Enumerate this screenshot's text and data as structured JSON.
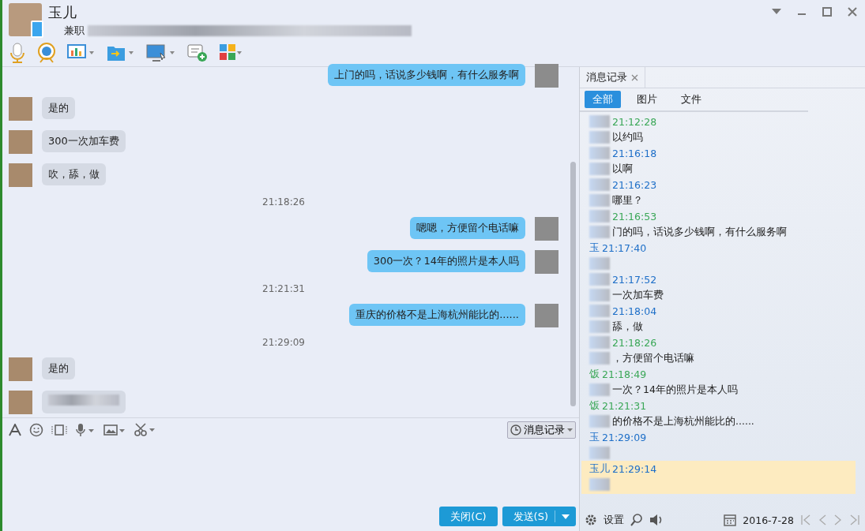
{
  "header": {
    "name": "玉儿",
    "status": "兼职"
  },
  "messages": [
    {
      "kind": "out",
      "text": "上门的吗，话说多少钱啊，有什么服务啊"
    },
    {
      "kind": "in",
      "text": "是的"
    },
    {
      "kind": "in",
      "text": "300一次加车费"
    },
    {
      "kind": "in",
      "text": "吹，舔，做"
    },
    {
      "kind": "time",
      "text": "21:18:26"
    },
    {
      "kind": "out",
      "text": "嗯嗯，方便留个电话嘛"
    },
    {
      "kind": "out",
      "text": "300一次？14年的照片是本人吗"
    },
    {
      "kind": "time",
      "text": "21:21:31"
    },
    {
      "kind": "out",
      "text": "重庆的价格不是上海杭州能比的......"
    },
    {
      "kind": "time",
      "text": "21:29:09"
    },
    {
      "kind": "in",
      "text": "是的"
    },
    {
      "kind": "in",
      "blurred": true
    }
  ],
  "history_button": "消息记录",
  "buttons": {
    "close": "关闭(C)",
    "send": "发送(S)"
  },
  "panel": {
    "tab": "消息记录",
    "filters": [
      {
        "label": "全部",
        "selected": true
      },
      {
        "label": "图片",
        "selected": false
      },
      {
        "label": "文件",
        "selected": false
      }
    ],
    "entries": [
      {
        "time": "21:12:28",
        "color": "#3aa757",
        "text": "以约吗",
        "highlighted": false
      },
      {
        "time": "21:16:18",
        "color": "#1e6fc8",
        "text": "以啊",
        "highlighted": false
      },
      {
        "time": "21:16:23",
        "color": "#1e6fc8",
        "text": "哪里？",
        "highlighted": false
      },
      {
        "time": "21:16:53",
        "color": "#3aa757",
        "text": "门的吗，话说多少钱啊，有什么服务啊",
        "highlighted": false
      },
      {
        "sender": "玉",
        "time": "21:17:40",
        "color": "#1e6fc8",
        "highlighted": false
      },
      {
        "time": "21:17:52",
        "color": "#1e6fc8",
        "text": "一次加车费",
        "highlighted": false
      },
      {
        "time": "21:18:04",
        "color": "#1e6fc8",
        "text": "舔，做",
        "highlighted": false
      },
      {
        "time": "21:18:26",
        "color": "#3aa757",
        "text": "，方便留个电话嘛",
        "highlighted": false
      },
      {
        "sender": "饭",
        "time": "21:18:49",
        "color": "#3aa757",
        "text": "一次？14年的照片是本人吗",
        "highlighted": false
      },
      {
        "sender": "饭",
        "time": "21:21:31",
        "color": "#3aa757",
        "text": "的价格不是上海杭州能比的......",
        "highlighted": false
      },
      {
        "sender": "玉",
        "time": "21:29:09",
        "color": "#1e6fc8",
        "highlighted": false
      },
      {
        "sender": "玉儿",
        "time": "21:29:14",
        "color": "#1e6fc8",
        "highlighted": true
      }
    ],
    "settings": "设置",
    "date": "2016-7-28"
  }
}
